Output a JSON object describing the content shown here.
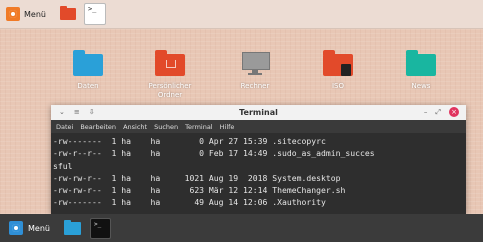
{
  "top_panel": {
    "menu_label": "Menü",
    "terminal_glyph": ">_"
  },
  "desktop": {
    "icons": [
      {
        "label": "Daten",
        "color": "#2aa0d8"
      },
      {
        "label": "Persönlicher\nOrdner",
        "color": "#e24a2a"
      },
      {
        "label": "Rechner",
        "color": "#9a9a9a"
      },
      {
        "label": "ISO",
        "color": "#e24a2a"
      },
      {
        "label": "News",
        "color": "#19b6a0"
      }
    ]
  },
  "terminal": {
    "title": "Terminal",
    "titlebar_left": [
      "⌄",
      "≡",
      "⇩"
    ],
    "window_buttons": [
      "–",
      "⤢",
      "×"
    ],
    "menu": [
      "Datei",
      "Bearbeiten",
      "Ansicht",
      "Suchen",
      "Terminal",
      "Hilfe"
    ],
    "lines": [
      "-rw-------  1 ha    ha        0 Apr 27 15:39 .sitecopyrc",
      "-rw-r--r--  1 ha    ha        0 Feb 17 14:49 .sudo_as_admin_succes",
      "sful",
      "-rw-rw-r--  1 ha    ha     1021 Aug 19  2018 System.desktop",
      "-rw-rw-r--  1 ha    ha      623 Mär 12 12:14 ThemeChanger.sh",
      "-rw-------  1 ha    ha       49 Aug 14 12:06 .Xauthority"
    ]
  },
  "bottom_panel": {
    "menu_label": "Menü",
    "terminal_glyph": ">_"
  }
}
